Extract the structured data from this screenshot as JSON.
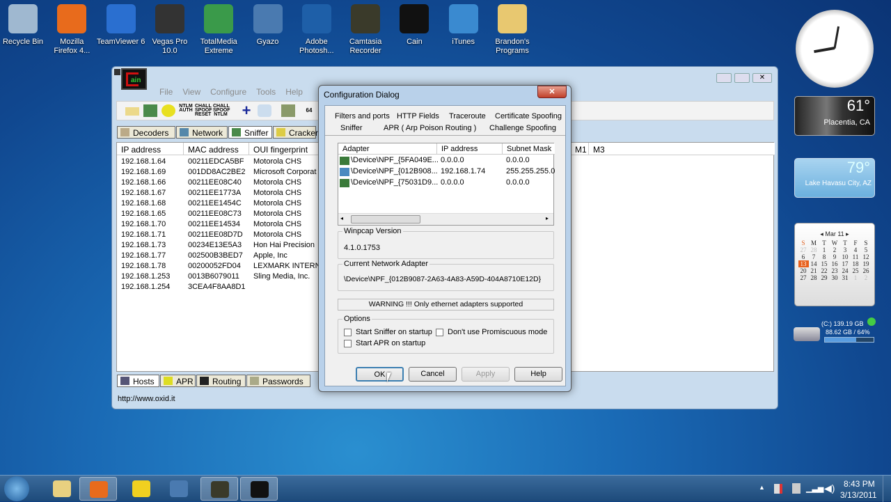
{
  "desktop": {
    "icons": [
      {
        "label": "Recycle Bin",
        "icon": "recycle-bin-icon",
        "color": "#9fb8d0"
      },
      {
        "label": "Mozilla Firefox 4...",
        "icon": "firefox-icon",
        "color": "#e86b1c"
      },
      {
        "label": "TeamViewer 6",
        "icon": "teamviewer-icon",
        "color": "#2a6fd0"
      },
      {
        "label": "Vegas Pro 10.0",
        "icon": "vegas-icon",
        "color": "#333333"
      },
      {
        "label": "TotalMedia Extreme",
        "icon": "totalmedia-icon",
        "color": "#3a9a4a"
      },
      {
        "label": "Gyazo",
        "icon": "gyazo-icon",
        "color": "#4a7ab0"
      },
      {
        "label": "Adobe Photosh...",
        "icon": "photoshop-icon",
        "color": "#1e5fa8"
      },
      {
        "label": "Camtasia Recorder",
        "icon": "camtasia-icon",
        "color": "#3a3a2a"
      },
      {
        "label": "Cain",
        "icon": "cain-icon",
        "color": "#111111"
      },
      {
        "label": "iTunes",
        "icon": "itunes-icon",
        "color": "#3a8ad0"
      },
      {
        "label": "Brandon's Programs",
        "icon": "folder-icon",
        "color": "#e8c870"
      }
    ]
  },
  "cain": {
    "menu": [
      "File",
      "View",
      "Configure",
      "Tools",
      "Help"
    ],
    "toolbar": [
      "NTLM AUTH",
      "CHALL SPOOF RESET",
      "CHALL SPOOF NTLM",
      "64"
    ],
    "tabs": [
      "Decoders",
      "Network",
      "Sniffer",
      "Cracker"
    ],
    "columns": [
      "IP address",
      "MAC address",
      "OUI fingerprint"
    ],
    "extra_columns": [
      "M1",
      "M3"
    ],
    "rows": [
      [
        "192.168.1.64",
        "00211EDCA5BF",
        "Motorola CHS"
      ],
      [
        "192.168.1.69",
        "001DD8AC2BE2",
        "Microsoft Corporat"
      ],
      [
        "192.168.1.66",
        "00211EE08C40",
        "Motorola CHS"
      ],
      [
        "192.168.1.67",
        "00211EE1773A",
        "Motorola CHS"
      ],
      [
        "192.168.1.68",
        "00211EE1454C",
        "Motorola CHS"
      ],
      [
        "192.168.1.65",
        "00211EE08C73",
        "Motorola CHS"
      ],
      [
        "192.168.1.70",
        "00211EE14534",
        "Motorola CHS"
      ],
      [
        "192.168.1.71",
        "00211EE08D7D",
        "Motorola CHS"
      ],
      [
        "192.168.1.73",
        "00234E13E5A3",
        "Hon Hai Precision"
      ],
      [
        "192.168.1.77",
        "002500B3BED7",
        "Apple, Inc"
      ],
      [
        "192.168.1.78",
        "00200052FD04",
        "LEXMARK INTERNA"
      ],
      [
        "192.168.1.253",
        "0013B6079011",
        "Sling Media, Inc."
      ],
      [
        "192.168.1.254",
        "3CEA4F8AA8D1",
        ""
      ]
    ],
    "bottom_tabs": [
      "Hosts",
      "APR",
      "Routing",
      "Passwords"
    ],
    "status": "http://www.oxid.it"
  },
  "dialog": {
    "title": "Configuration Dialog",
    "tabs_row1": [
      "Filters and ports",
      "HTTP Fields",
      "Traceroute",
      "Certificate Spoofing"
    ],
    "tabs_row2": [
      "Sniffer",
      "APR ( Arp Poison Routing )",
      "Challenge Spoofing"
    ],
    "active_tab": "Sniffer",
    "adapter_columns": [
      "Adapter",
      "IP address",
      "Subnet Mask"
    ],
    "adapters": [
      [
        "\\Device\\NPF_{5FA049E...",
        "0.0.0.0",
        "0.0.0.0"
      ],
      [
        "\\Device\\NPF_{012B908...",
        "192.168.1.74",
        "255.255.255.0"
      ],
      [
        "\\Device\\NPF_{75031D9...",
        "0.0.0.0",
        "0.0.0.0"
      ]
    ],
    "winpcap_label": "Winpcap Version",
    "winpcap_value": "4.1.0.1753",
    "current_label": "Current Network Adapter",
    "current_value": "\\Device\\NPF_{012B9087-2A63-4A83-A59D-404A8710E12D}",
    "warning": "WARNING !!! Only ethernet adapters supported",
    "options_label": "Options",
    "options": [
      {
        "label": "Start Sniffer on startup",
        "checked": false
      },
      {
        "label": "Don't use Promiscuous mode",
        "checked": false
      },
      {
        "label": "Start APR on startup",
        "checked": false
      }
    ],
    "buttons": {
      "ok": "OK",
      "cancel": "Cancel",
      "apply": "Apply",
      "help": "Help"
    }
  },
  "gadgets": {
    "weather1": {
      "temp": "61°",
      "city": "Placentia, CA"
    },
    "weather2": {
      "temp": "79°",
      "city": "Lake Havasu City, AZ"
    },
    "calendar": {
      "month": "Mar 11",
      "days": [
        "S",
        "M",
        "T",
        "W",
        "T",
        "F",
        "S"
      ],
      "weeks": [
        [
          "27",
          "28",
          "1",
          "2",
          "3",
          "4",
          "5"
        ],
        [
          "6",
          "7",
          "8",
          "9",
          "10",
          "11",
          "12"
        ],
        [
          "13",
          "14",
          "15",
          "16",
          "17",
          "18",
          "19"
        ],
        [
          "20",
          "21",
          "22",
          "23",
          "24",
          "25",
          "26"
        ],
        [
          "27",
          "28",
          "29",
          "30",
          "31",
          "1",
          "2"
        ]
      ],
      "today": "13"
    },
    "drive": {
      "line1": "(C:) 139.19 GB",
      "line2": "88.62 GB / 64%",
      "used_percent": 64
    }
  },
  "taskbar": {
    "time": "8:43 PM",
    "date": "3/13/2011"
  }
}
